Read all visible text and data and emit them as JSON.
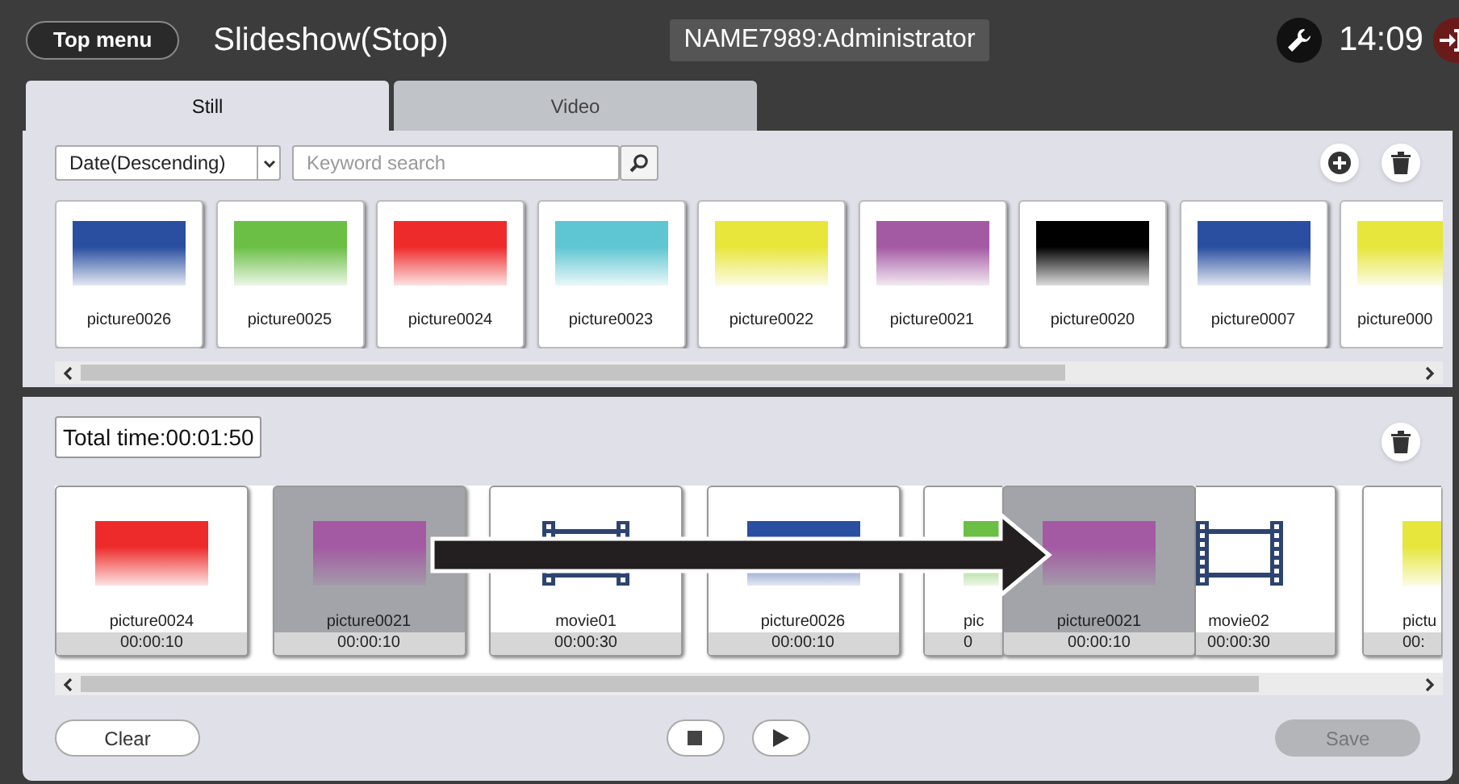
{
  "header": {
    "menu_button": "Top menu",
    "title": "Slideshow(Stop)",
    "user": "NAME7989:Administrator",
    "time": "14:09"
  },
  "tabs": [
    {
      "label": "Still",
      "selected": true
    },
    {
      "label": "Video",
      "selected": false
    }
  ],
  "library": {
    "sort": {
      "value": "Date(Descending)"
    },
    "search": {
      "placeholder": "Keyword search"
    },
    "items": [
      {
        "label": "picture0026",
        "color": "#2a4ea0",
        "clipped": false
      },
      {
        "label": "picture0025",
        "color": "#6bbf45",
        "clipped": false
      },
      {
        "label": "picture0024",
        "color": "#ee2b2b",
        "clipped": false
      },
      {
        "label": "picture0023",
        "color": "#5ec6d2",
        "clipped": false
      },
      {
        "label": "picture0022",
        "color": "#e8e63a",
        "clipped": false
      },
      {
        "label": "picture0021",
        "color": "#a35aa3",
        "clipped": false
      },
      {
        "label": "picture0020",
        "color": "#000000",
        "clipped": false
      },
      {
        "label": "picture0007",
        "color": "#2a4ea0",
        "clipped": false
      },
      {
        "label": "picture000",
        "color": "#e6e63c",
        "clipped": true
      }
    ]
  },
  "playlist": {
    "total_time": "Total time:00:01:50",
    "items": [
      {
        "kind": "picture",
        "label": "picture0024",
        "duration": "00:00:10",
        "color": "#ee2b2b",
        "selected": false,
        "clipped": false,
        "covered": false
      },
      {
        "kind": "picture",
        "label": "picture0021",
        "duration": "00:00:10",
        "color": "#a35aa3",
        "selected": true,
        "clipped": false,
        "covered": false
      },
      {
        "kind": "movie",
        "label": "movie01",
        "duration": "00:00:30",
        "selected": false,
        "clipped": false,
        "covered": false
      },
      {
        "kind": "picture",
        "label": "picture0026",
        "duration": "00:00:10",
        "color": "#2a4ea0",
        "selected": false,
        "clipped": false,
        "covered": false
      },
      {
        "kind": "picture",
        "label": "pic",
        "duration": "0",
        "color": "#6bbf45",
        "selected": false,
        "clipped": true,
        "covered": false
      },
      {
        "kind": "movie",
        "label": "movie02",
        "duration": "00:00:30",
        "selected": false,
        "clipped": false,
        "covered": true
      },
      {
        "kind": "picture",
        "label": "pictu",
        "duration": "00:",
        "color": "#e6e63c",
        "selected": false,
        "clipped": true,
        "covered": false
      }
    ],
    "dragging": {
      "label": "picture0021",
      "duration": "00:00:10",
      "color": "#a35aa3"
    }
  },
  "buttons": {
    "clear": "Clear",
    "save": "Save",
    "save_disabled": true
  }
}
